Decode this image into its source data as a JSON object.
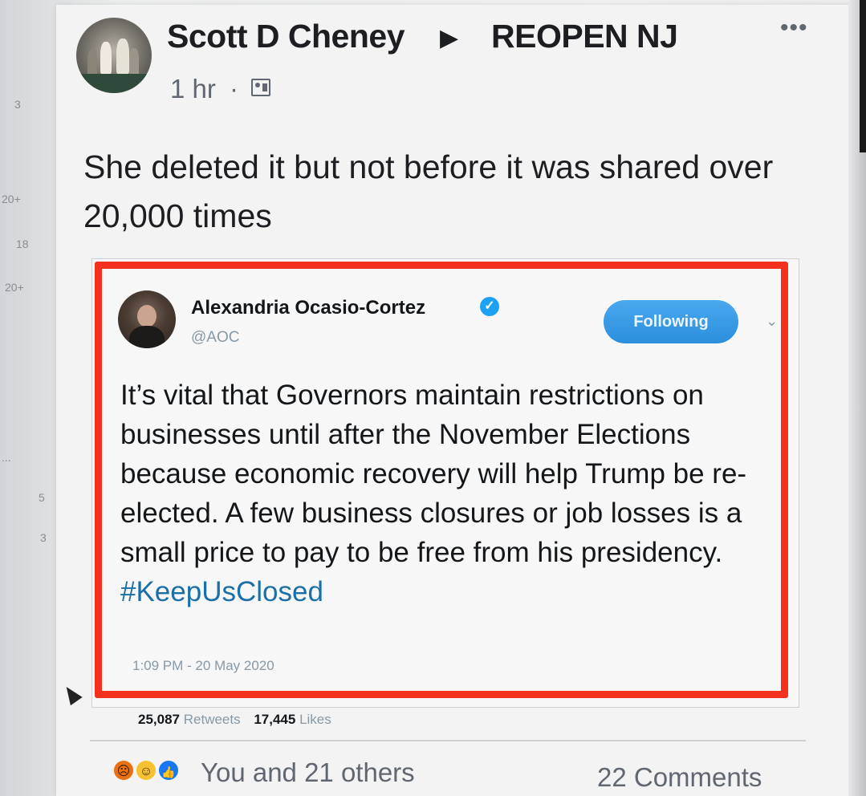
{
  "post": {
    "poster_name": "Scott D Cheney",
    "arrow_glyph": "▶",
    "group_name": "REOPEN NJ",
    "more_glyph": "•••",
    "time": "1 hr",
    "time_separator": "·",
    "audience_icon": "group-audience-icon",
    "text": "She deleted it but not before it was shared over 20,000 times"
  },
  "sidebar": {
    "counts": [
      "3",
      "20+",
      "18",
      "20+",
      "...",
      "5",
      "3"
    ]
  },
  "tweet": {
    "author_name": "Alexandria Ocasio-Cortez",
    "verified_glyph": "✓",
    "handle": "@AOC",
    "follow_label": "Following",
    "chevron_glyph": "⌄",
    "text_main": "It’s vital that Governors maintain restrictions on businesses until after the November Elections because economic recovery will help Trump be re-elected. A few business closures or job losses is a small price to pay to be free from his presidency.",
    "hashtag": "#KeepUsClosed",
    "timestamp": "1:09 PM - 20 May 2020",
    "retweets_count": "25,087",
    "retweets_label": "Retweets",
    "likes_count": "17,445",
    "likes_label": "Likes"
  },
  "footer": {
    "reactions_text": "You and 21 others",
    "comments_text": "22 Comments",
    "reaction_icons": [
      "angry",
      "wow",
      "like"
    ]
  },
  "colors": {
    "highlight_border": "#f4301f",
    "twitter_blue": "#1da1f2",
    "hashtag": "#1b6fa8",
    "text_primary": "#1c1e21",
    "text_secondary": "#606770"
  }
}
